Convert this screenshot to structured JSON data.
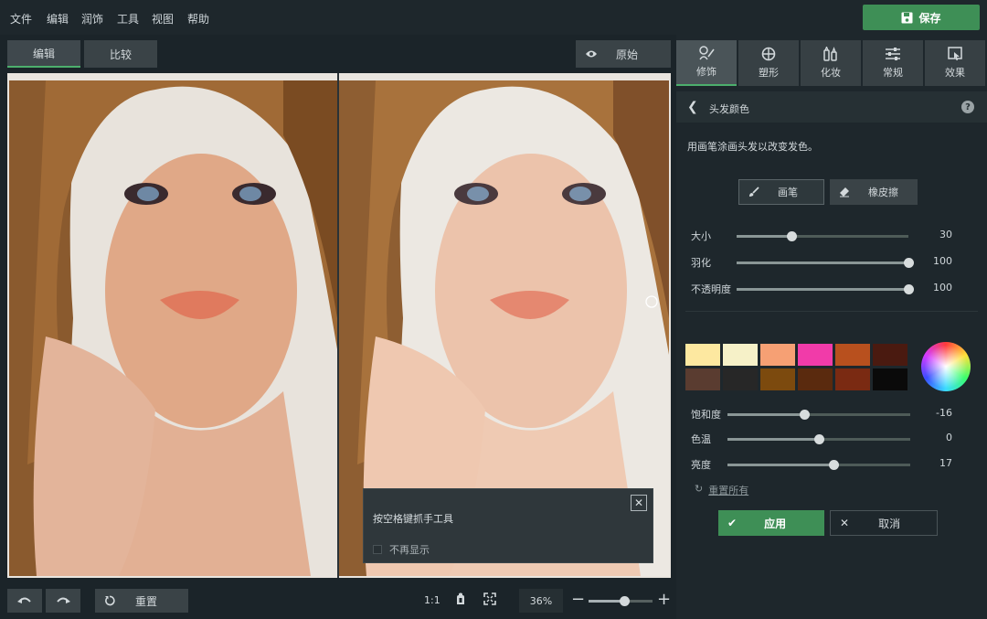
{
  "menu": [
    "文件",
    "编辑",
    "润饰",
    "工具",
    "视图",
    "帮助"
  ],
  "save_label": "保存",
  "view_tabs": {
    "edit": "编辑",
    "compare": "比较"
  },
  "original_label": "原始",
  "tooltip": {
    "text": "按空格键抓手工具",
    "checkbox": "不再显示"
  },
  "bottom": {
    "reset": "重置",
    "ratio": "1:1",
    "zoom": "36%",
    "zoom_level": 0.55
  },
  "tool_tabs": [
    "修饰",
    "塑形",
    "化妆",
    "常规",
    "效果"
  ],
  "section_title": "头发颜色",
  "description": "用画笔涂画头发以改变发色。",
  "brush_label": "画笔",
  "eraser_label": "橡皮擦",
  "brush_sliders": [
    {
      "label": "大小",
      "value": "30",
      "fraction": 0.32
    },
    {
      "label": "羽化",
      "value": "100",
      "fraction": 1.0
    },
    {
      "label": "不透明度",
      "value": "100",
      "fraction": 1.0
    }
  ],
  "swatches": [
    "#fde8a0",
    "#f6f1c8",
    "#f6a074",
    "#f13ba9",
    "#b8501e",
    "#4a1a10",
    "#5a3c30",
    "#272727",
    "#7c4a0e",
    "#5a2a0e",
    "#7a2a12",
    "#0a0a0a"
  ],
  "color_sliders": [
    {
      "label": "饱和度",
      "value": "-16",
      "fraction": 0.42
    },
    {
      "label": "色温",
      "value": "0",
      "fraction": 0.5
    },
    {
      "label": "亮度",
      "value": "17",
      "fraction": 0.58
    }
  ],
  "reset_all": "重置所有",
  "apply_label": "应用",
  "cancel_label": "取消",
  "colors": {
    "accent": "#3e8f56",
    "panel": "#1e272c"
  }
}
